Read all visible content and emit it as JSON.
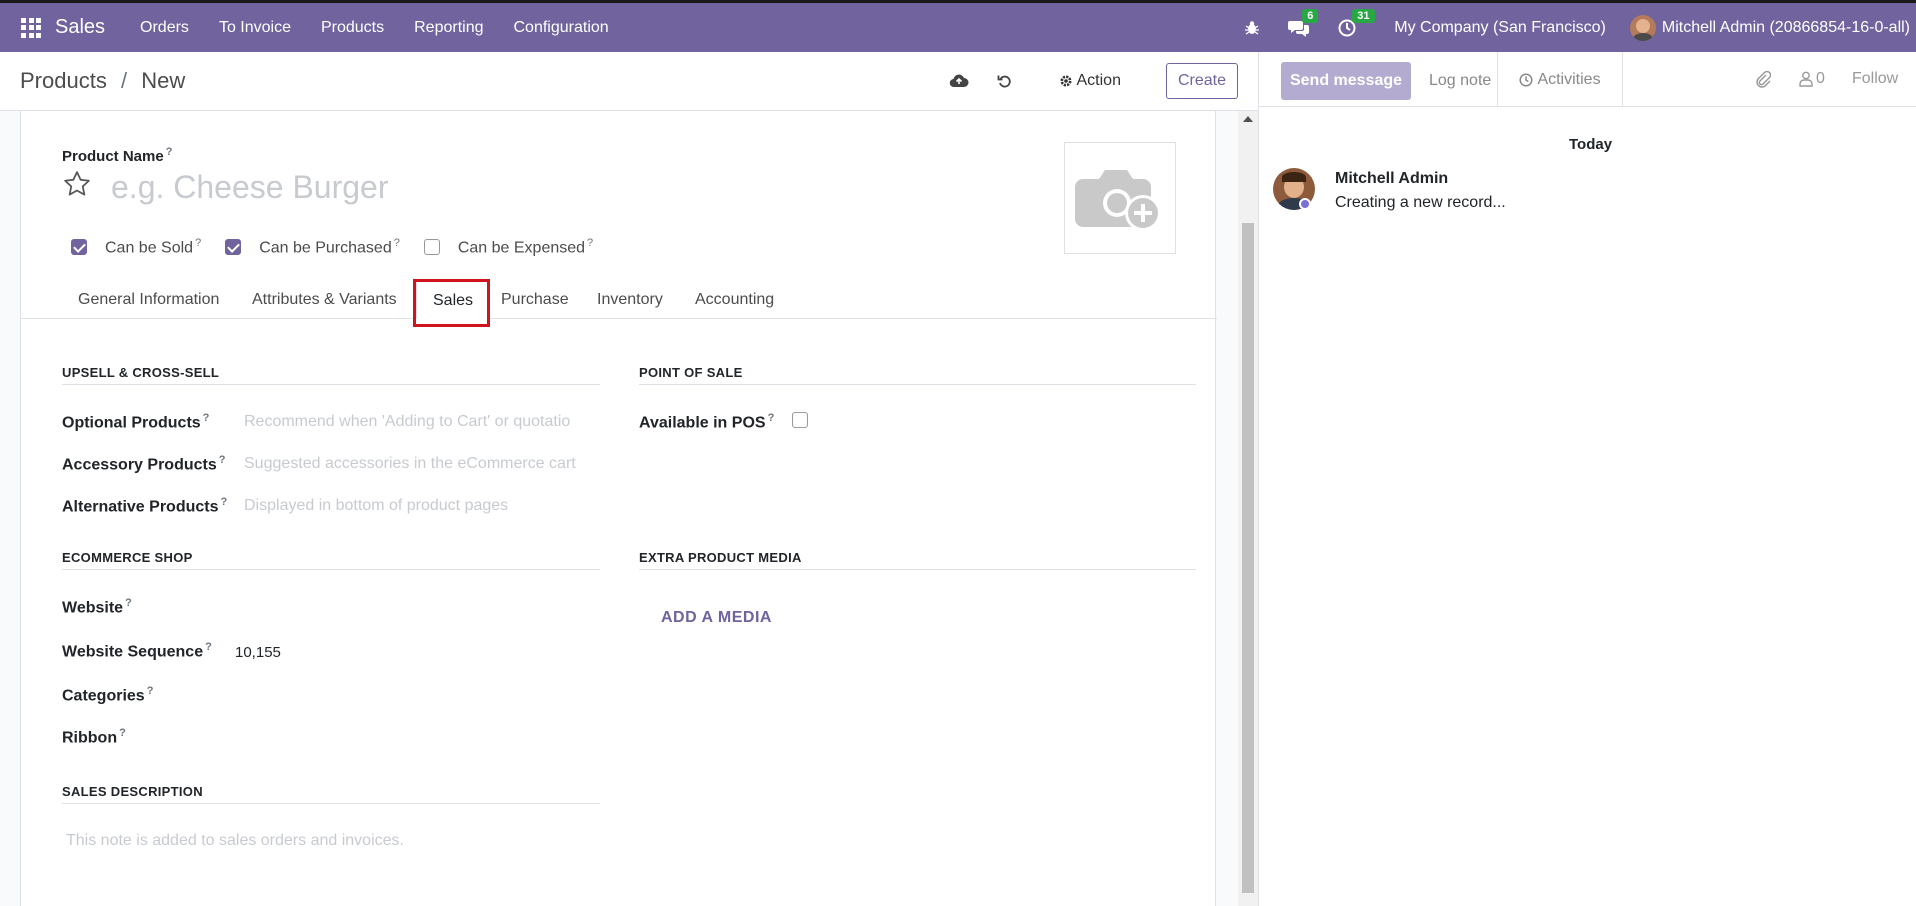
{
  "navbar": {
    "app_name": "Sales",
    "menus": [
      "Orders",
      "To Invoice",
      "Products",
      "Reporting",
      "Configuration"
    ],
    "messages_badge": "6",
    "activities_badge": "31",
    "company": "My Company (San Francisco)",
    "user": "Mitchell Admin (20866854-16-0-all)",
    "accent_color": "#71639e"
  },
  "control_panel": {
    "breadcrumb_parent": "Products",
    "breadcrumb_sep": "/",
    "breadcrumb_current": "New",
    "action_label": "Action",
    "create_label": "Create"
  },
  "form": {
    "product_name_label": "Product Name",
    "product_name_placeholder": "e.g. Cheese Burger",
    "help_mark": "?",
    "checkboxes": [
      {
        "label": "Can be Sold",
        "checked": true
      },
      {
        "label": "Can be Purchased",
        "checked": true
      },
      {
        "label": "Can be Expensed",
        "checked": false
      }
    ],
    "tabs": [
      "General Information",
      "Attributes & Variants",
      "Sales",
      "Purchase",
      "Inventory",
      "Accounting"
    ],
    "active_tab": "Sales",
    "upsell": {
      "title": "UPSELL & CROSS-SELL",
      "optional_label": "Optional Products",
      "optional_placeholder": "Recommend when 'Adding to Cart' or quotatio",
      "accessory_label": "Accessory Products",
      "accessory_placeholder": "Suggested accessories in the eCommerce cart",
      "alternative_label": "Alternative Products",
      "alternative_placeholder": "Displayed in bottom of product pages"
    },
    "pos": {
      "title": "POINT OF SALE",
      "available_label": "Available in POS",
      "available_checked": false
    },
    "ecommerce": {
      "title": "ECOMMERCE SHOP",
      "website_label": "Website",
      "sequence_label": "Website Sequence",
      "sequence_value": "10,155",
      "categories_label": "Categories",
      "ribbon_label": "Ribbon"
    },
    "media": {
      "title": "EXTRA PRODUCT MEDIA",
      "add_label": "ADD A MEDIA"
    },
    "description": {
      "title": "SALES DESCRIPTION",
      "placeholder": "This note is added to sales orders and invoices."
    }
  },
  "chatter": {
    "send_message": "Send message",
    "log_note": "Log note",
    "activities": "Activities",
    "followers_count": "0",
    "follow": "Follow",
    "date_separator": "Today",
    "message_author": "Mitchell Admin",
    "message_body": "Creating a new record..."
  }
}
